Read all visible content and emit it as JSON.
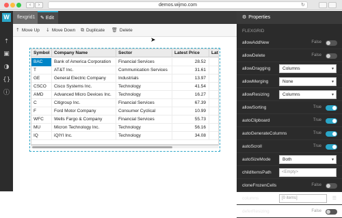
{
  "browser": {
    "url": "demos.wijmo.com"
  },
  "rail": {
    "logo": "W"
  },
  "tabs": {
    "file": "flexgrid1",
    "edit": "Edit"
  },
  "toolbar": {
    "move_up": "Move Up",
    "move_down": "Move Down",
    "duplicate": "Duplicate",
    "delete": "Delete"
  },
  "grid": {
    "columns": [
      "Symbol",
      "Company Name",
      "Sector",
      "Latest Price",
      "Lat"
    ],
    "rows": [
      [
        "BAC",
        "Bank of America Corporation",
        "Financial Services",
        "28.52"
      ],
      [
        "T",
        "AT&T Inc.",
        "Communication Services",
        "31.61"
      ],
      [
        "GE",
        "General Electric Company",
        "Industrials",
        "13.97"
      ],
      [
        "CSCO",
        "Cisco Systems Inc.",
        "Technology",
        "41.54"
      ],
      [
        "AMD",
        "Advanced Micro Devices Inc.",
        "Technology",
        "16.27"
      ],
      [
        "C",
        "Citigroup Inc.",
        "Financial Services",
        "67.39"
      ],
      [
        "F",
        "Ford Motor Company",
        "Consumer Cyclical",
        "10.99"
      ],
      [
        "WFC",
        "Wells Fargo & Company",
        "Financial Services",
        "55.73"
      ],
      [
        "MU",
        "Micron Technology Inc.",
        "Technology",
        "56.16"
      ],
      [
        "IQ",
        "iQIYI Inc.",
        "Technology",
        "34.08"
      ]
    ]
  },
  "properties": {
    "tab_label": "Properties",
    "section": "FLEXGRID",
    "items": [
      {
        "label": "allowAddNew",
        "bool": "False",
        "kind": "toggle",
        "on": false
      },
      {
        "label": "allowDelete",
        "bool": "False",
        "kind": "toggle",
        "on": false
      },
      {
        "label": "allowDragging",
        "kind": "select",
        "value": "Columns"
      },
      {
        "label": "allowMerging",
        "kind": "select",
        "value": "None"
      },
      {
        "label": "allowResizing",
        "kind": "select",
        "value": "Columns"
      },
      {
        "label": "allowSorting",
        "bool": "True",
        "kind": "toggle",
        "on": true
      },
      {
        "label": "autoClipboard",
        "bool": "True",
        "kind": "toggle",
        "on": true
      },
      {
        "label": "autoGenerateColumns",
        "bool": "True",
        "kind": "toggle",
        "on": true
      },
      {
        "label": "autoScroll",
        "bool": "True",
        "kind": "toggle",
        "on": true
      },
      {
        "label": "autoSizeMode",
        "kind": "select",
        "value": "Both"
      },
      {
        "label": "childItemsPath",
        "kind": "input",
        "value": "<Empty>"
      },
      {
        "label": "cloneFrozenCells",
        "bool": "False",
        "kind": "toggle",
        "on": false
      },
      {
        "label": "columns",
        "kind": "input-menu",
        "value": "[0 items]"
      },
      {
        "label": "deferResizing",
        "bool": "False",
        "kind": "toggle",
        "on": false
      }
    ]
  },
  "colors": {
    "accent": "#2aa6c8",
    "selection": "#0085c7",
    "panel_bg": "#2b2b2b"
  }
}
